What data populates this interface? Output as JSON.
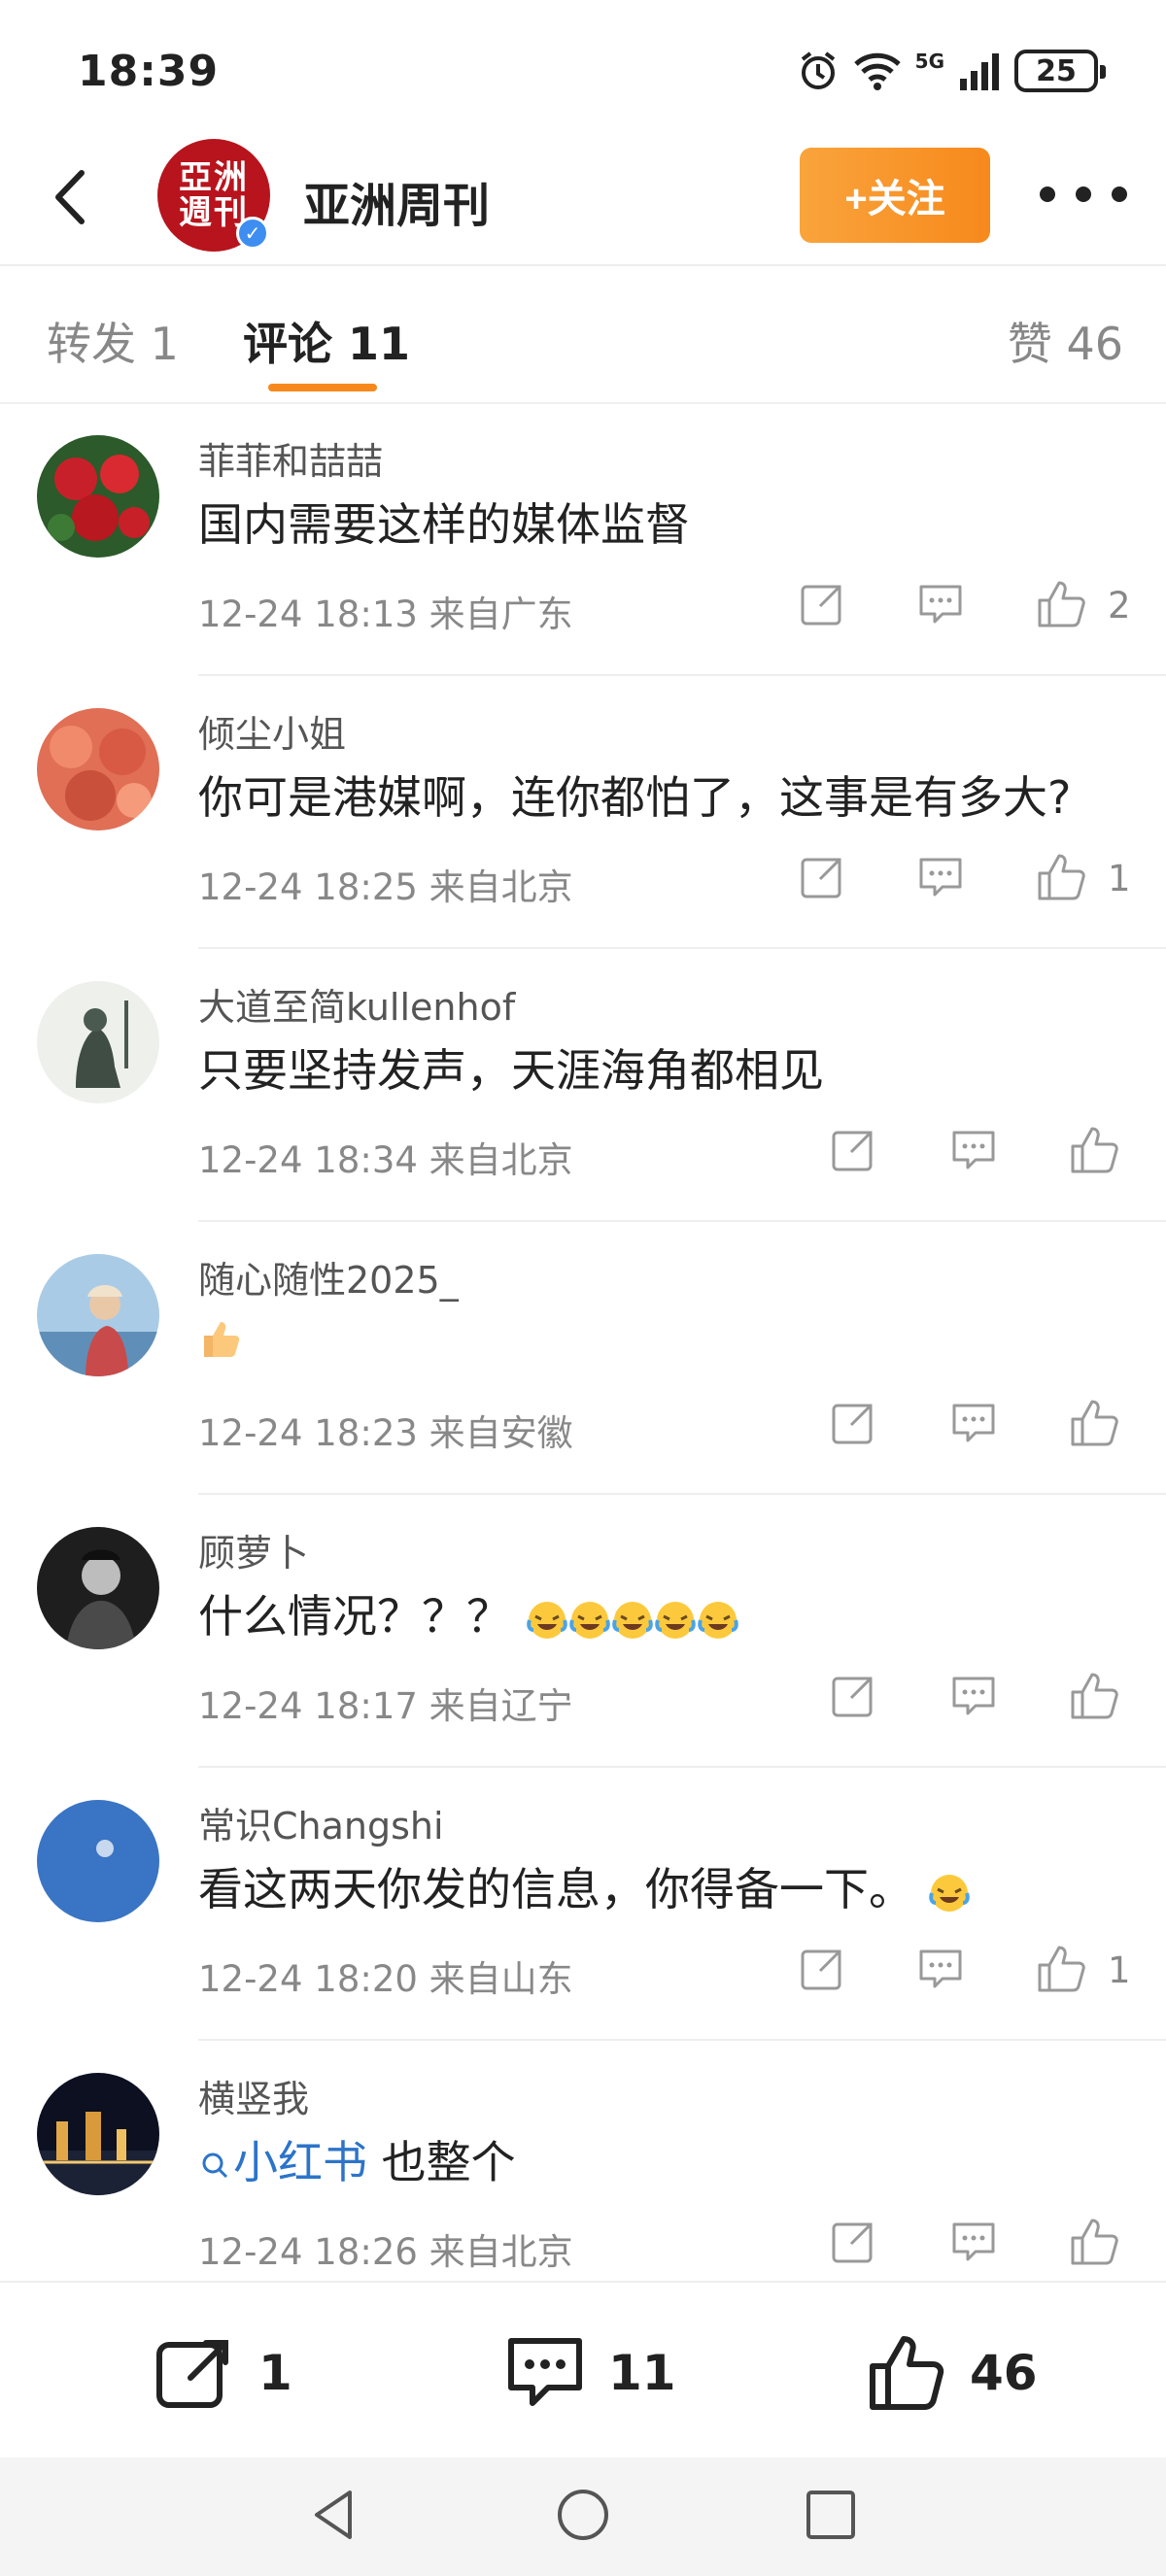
{
  "status_bar": {
    "time": "18:39",
    "network": "5G",
    "battery": "25"
  },
  "header": {
    "account_name": "亚洲周刊",
    "avatar_text_line1": "亞洲",
    "avatar_text_line2": "週刊",
    "follow_label": "+关注"
  },
  "tabs": {
    "repost": "转发 1",
    "comments": "评论 11",
    "likes": "赞 46"
  },
  "comments": [
    {
      "user": "菲菲和喆喆",
      "text": "国内需要这样的媒体监督",
      "meta": "12-24 18:13 来自广东",
      "likes": "2"
    },
    {
      "user": "倾尘小姐",
      "text": "你可是港媒啊，连你都怕了，这事是有多大?",
      "meta": "12-24 18:25 来自北京",
      "likes": "1"
    },
    {
      "user": "大道至简kullenhof",
      "text": "只要坚持发声，天涯海角都相见",
      "meta": "12-24 18:34 来自北京",
      "likes": ""
    },
    {
      "user": "随心随性2025_",
      "text": "",
      "emoji": "thumbs-up",
      "meta": "12-24 18:23 来自安徽",
      "likes": ""
    },
    {
      "user": "顾萝卜",
      "text": "什么情况？？？",
      "emoji": "crying-laughing x5",
      "meta": "12-24 18:17 来自辽宁",
      "likes": ""
    },
    {
      "user": "常识Changshi",
      "text": "看这两天你发的信息，你得备一下。",
      "emoji": "crying-laughing",
      "meta": "12-24 18:20 来自山东",
      "likes": "1"
    },
    {
      "user": "横竖我",
      "link": "小红书",
      "text": " 也整个",
      "meta": "12-24 18:26 来自北京",
      "likes": ""
    }
  ],
  "bottom_bar": {
    "repost_count": "1",
    "comment_count": "11",
    "like_count": "46"
  },
  "colors": {
    "accent_orange": "#f7891c",
    "avatar_red": "#b8141d",
    "verified_blue": "#3d8ef0",
    "link_blue": "#2c74c9"
  }
}
